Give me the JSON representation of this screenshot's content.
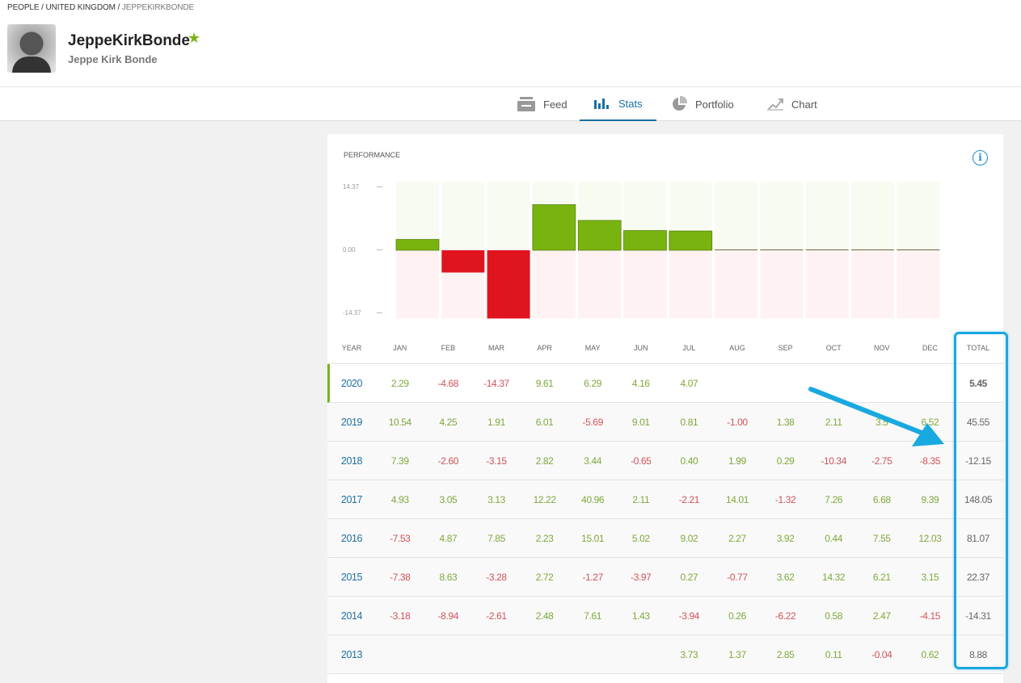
{
  "breadcrumb": [
    "PEOPLE",
    "UNITED KINGDOM",
    "JEPPEKIRKBONDE"
  ],
  "profile": {
    "username": "JeppeKirkBonde",
    "full_name": "Jeppe Kirk Bonde",
    "star_icon": "star-icon"
  },
  "tabs": [
    {
      "label": "Feed",
      "icon": "feed-icon"
    },
    {
      "label": "Stats",
      "icon": "bar-chart-icon",
      "active": true
    },
    {
      "label": "Portfolio",
      "icon": "pie-chart-icon"
    },
    {
      "label": "Chart",
      "icon": "line-chart-icon"
    }
  ],
  "colors": {
    "accent": "#1a6fa0",
    "positive": "#7ab317",
    "negative": "#e0141e",
    "highlight": "#19a8e0"
  },
  "performance": {
    "title": "PERFORMANCE",
    "info_icon": "info-icon",
    "y_ticks": [
      "14.37",
      "0.00",
      "-14.37"
    ]
  },
  "chart_data": {
    "type": "bar",
    "categories": [
      "JAN",
      "FEB",
      "MAR",
      "APR",
      "MAY",
      "JUN",
      "JUL",
      "AUG",
      "SEP",
      "OCT",
      "NOV",
      "DEC"
    ],
    "values": [
      2.29,
      -4.68,
      -14.37,
      9.61,
      6.29,
      4.16,
      4.07,
      0,
      0,
      0,
      0,
      0
    ],
    "ylim": [
      -14.37,
      14.37
    ]
  },
  "table": {
    "headers": [
      "YEAR",
      "JAN",
      "FEB",
      "MAR",
      "APR",
      "MAY",
      "JUN",
      "JUL",
      "AUG",
      "SEP",
      "OCT",
      "NOV",
      "DEC",
      "TOTAL"
    ],
    "rows": [
      {
        "year": "2020",
        "months": [
          "2.29",
          "-4.68",
          "-14.37",
          "9.61",
          "6.29",
          "4.16",
          "4.07",
          "",
          "",
          "",
          "",
          ""
        ],
        "total": "5.45"
      },
      {
        "year": "2019",
        "months": [
          "10.54",
          "4.25",
          "1.91",
          "6.01",
          "-5.69",
          "9.01",
          "0.81",
          "-1.00",
          "1.38",
          "2.11",
          "3.5",
          "6.52"
        ],
        "total": "45.55"
      },
      {
        "year": "2018",
        "months": [
          "7.39",
          "-2.60",
          "-3.15",
          "2.82",
          "3.44",
          "-0.65",
          "0.40",
          "1.99",
          "0.29",
          "-10.34",
          "-2.75",
          "-8.35"
        ],
        "total": "-12.15"
      },
      {
        "year": "2017",
        "months": [
          "4.93",
          "3.05",
          "3.13",
          "12.22",
          "40.96",
          "2.11",
          "-2.21",
          "14.01",
          "-1.32",
          "7.26",
          "6.68",
          "9.39"
        ],
        "total": "148.05"
      },
      {
        "year": "2016",
        "months": [
          "-7.53",
          "4.87",
          "7.85",
          "2.23",
          "15.01",
          "5.02",
          "9.02",
          "2.27",
          "3.92",
          "0.44",
          "7.55",
          "12.03"
        ],
        "total": "81.07"
      },
      {
        "year": "2015",
        "months": [
          "-7.38",
          "8.63",
          "-3.28",
          "2.72",
          "-1.27",
          "-3.97",
          "0.27",
          "-0.77",
          "3.62",
          "14.32",
          "6.21",
          "3.15"
        ],
        "total": "22.37"
      },
      {
        "year": "2014",
        "months": [
          "-3.18",
          "-8.94",
          "-2.61",
          "2.48",
          "7.61",
          "1.43",
          "-3.94",
          "0.26",
          "-6.22",
          "0.58",
          "2.47",
          "-4.15"
        ],
        "total": "-14.31"
      },
      {
        "year": "2013",
        "months": [
          "",
          "",
          "",
          "",
          "",
          "",
          "3.73",
          "1.37",
          "2.85",
          "0.11",
          "-0.04",
          "0.62"
        ],
        "total": "8.88"
      }
    ]
  }
}
